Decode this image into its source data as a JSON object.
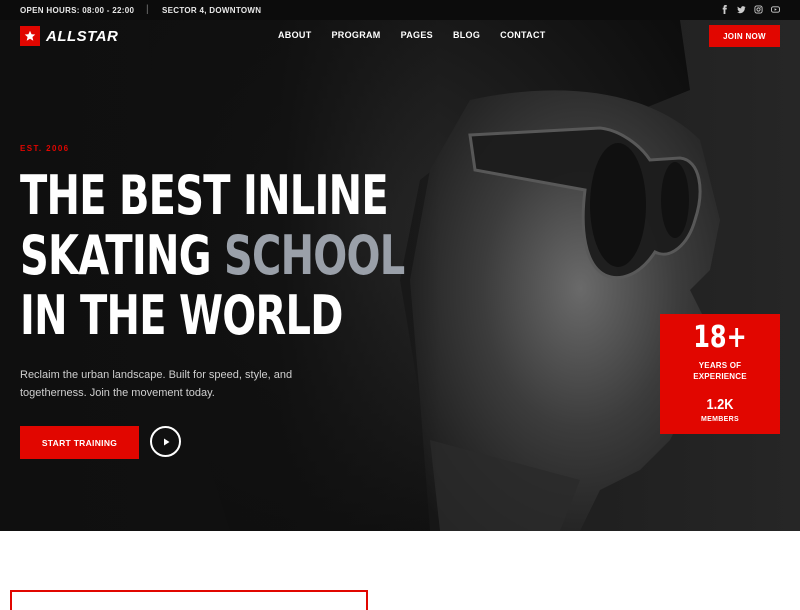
{
  "topbar": {
    "hours": "OPEN HOURS: 08:00 - 22:00",
    "separator": "|",
    "address": "SECTOR 4, DOWNTOWN",
    "social_icons": [
      "facebook-icon",
      "twitter-icon",
      "instagram-icon",
      "youtube-icon"
    ]
  },
  "brand": {
    "name": "ALLSTAR",
    "logo_icon": "star-icon",
    "accent": "#e10600"
  },
  "nav": {
    "items": [
      "ABOUT",
      "PROGRAM",
      "PAGES",
      "BLOG",
      "CONTACT"
    ],
    "cta": "JOIN NOW"
  },
  "hero": {
    "eyebrow": "EST. 2006",
    "headline_line1": "THE BEST INLINE",
    "headline_line2a": "SKATING ",
    "headline_line2b": "SCHOOL",
    "headline_line3": "IN THE WORLD",
    "lede": "Reclaim the urban landscape. Built for speed, style, and togetherness. Join the movement today.",
    "cta": "START TRAINING",
    "play_icon": "play-icon"
  },
  "stats": {
    "years_value": "18+",
    "years_label_1": "YEARS OF",
    "years_label_2": "EXPERIENCE",
    "members_value": "1.2K",
    "members_label": "MEMBERS"
  }
}
